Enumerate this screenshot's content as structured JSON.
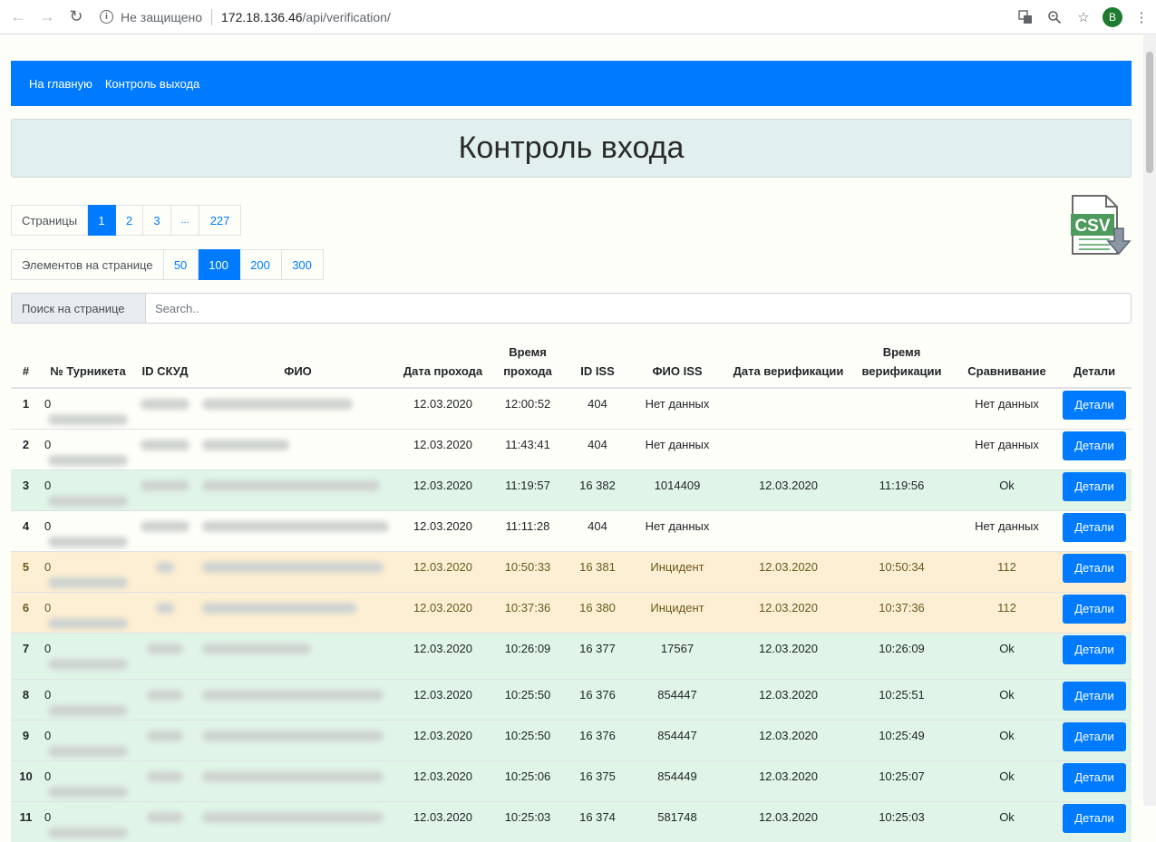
{
  "browser": {
    "security_label": "Не защищено",
    "url_host": "172.18.136.46",
    "url_path": "/api/verification/",
    "profile_initial": "B"
  },
  "nav": {
    "home": "На главную",
    "exit_control": "Контроль выхода"
  },
  "page_title": "Контроль входа",
  "pages": {
    "label": "Страницы",
    "items": [
      "1",
      "2",
      "3",
      "...",
      "227"
    ],
    "active": "1"
  },
  "per_page": {
    "label": "Элементов на странице",
    "items": [
      "50",
      "100",
      "200",
      "300"
    ],
    "active": "100"
  },
  "search": {
    "label": "Поиск на странице",
    "placeholder": "Search.."
  },
  "table": {
    "headers": [
      "#",
      "№ Турникета",
      "ID СКУД",
      "ФИО",
      "Дата прохода",
      "Время прохода",
      "ID ISS",
      "ФИО ISS",
      "Дата верификации",
      "Время верификации",
      "Сравнивание",
      "Детали"
    ],
    "details_label": "Детали",
    "rows": [
      {
        "n": "1",
        "turn": "0",
        "date": "12.03.2020",
        "time": "12:00:52",
        "iss": "404",
        "fio_iss": "Нет данных",
        "vdate": "",
        "vtime": "",
        "cmp": "Нет данных",
        "status": "white"
      },
      {
        "n": "2",
        "turn": "0",
        "date": "12.03.2020",
        "time": "11:43:41",
        "iss": "404",
        "fio_iss": "Нет данных",
        "vdate": "",
        "vtime": "",
        "cmp": "Нет данных",
        "status": "white"
      },
      {
        "n": "3",
        "turn": "0",
        "date": "12.03.2020",
        "time": "11:19:57",
        "iss": "16 382",
        "fio_iss": "1014409",
        "vdate": "12.03.2020",
        "vtime": "11:19:56",
        "cmp": "Ok",
        "status": "green"
      },
      {
        "n": "4",
        "turn": "0",
        "date": "12.03.2020",
        "time": "11:11:28",
        "iss": "404",
        "fio_iss": "Нет данных",
        "vdate": "",
        "vtime": "",
        "cmp": "Нет данных",
        "status": "white"
      },
      {
        "n": "5",
        "turn": "0",
        "date": "12.03.2020",
        "time": "10:50:33",
        "iss": "16 381",
        "fio_iss": "Инцидент",
        "vdate": "12.03.2020",
        "vtime": "10:50:34",
        "cmp": "112",
        "status": "yellow"
      },
      {
        "n": "6",
        "turn": "0",
        "date": "12.03.2020",
        "time": "10:37:36",
        "iss": "16 380",
        "fio_iss": "Инцидент",
        "vdate": "12.03.2020",
        "vtime": "10:37:36",
        "cmp": "112",
        "status": "yellow"
      },
      {
        "n": "7",
        "turn": "0",
        "date": "12.03.2020",
        "time": "10:26:09",
        "iss": "16 377",
        "fio_iss": "17567",
        "vdate": "12.03.2020",
        "vtime": "10:26:09",
        "cmp": "Ok",
        "status": "green"
      },
      {
        "n": "8",
        "turn": "0",
        "date": "12.03.2020",
        "time": "10:25:50",
        "iss": "16 376",
        "fio_iss": "854447",
        "vdate": "12.03.2020",
        "vtime": "10:25:51",
        "cmp": "Ok",
        "status": "green"
      },
      {
        "n": "9",
        "turn": "0",
        "date": "12.03.2020",
        "time": "10:25:50",
        "iss": "16 376",
        "fio_iss": "854447",
        "vdate": "12.03.2020",
        "vtime": "10:25:49",
        "cmp": "Ok",
        "status": "green"
      },
      {
        "n": "10",
        "turn": "0",
        "date": "12.03.2020",
        "time": "10:25:06",
        "iss": "16 375",
        "fio_iss": "854449",
        "vdate": "12.03.2020",
        "vtime": "10:25:07",
        "cmp": "Ok",
        "status": "green"
      },
      {
        "n": "11",
        "turn": "0",
        "date": "12.03.2020",
        "time": "10:25:03",
        "iss": "16 374",
        "fio_iss": "581748",
        "vdate": "12.03.2020",
        "vtime": "10:25:03",
        "cmp": "Ok",
        "status": "green"
      }
    ]
  }
}
